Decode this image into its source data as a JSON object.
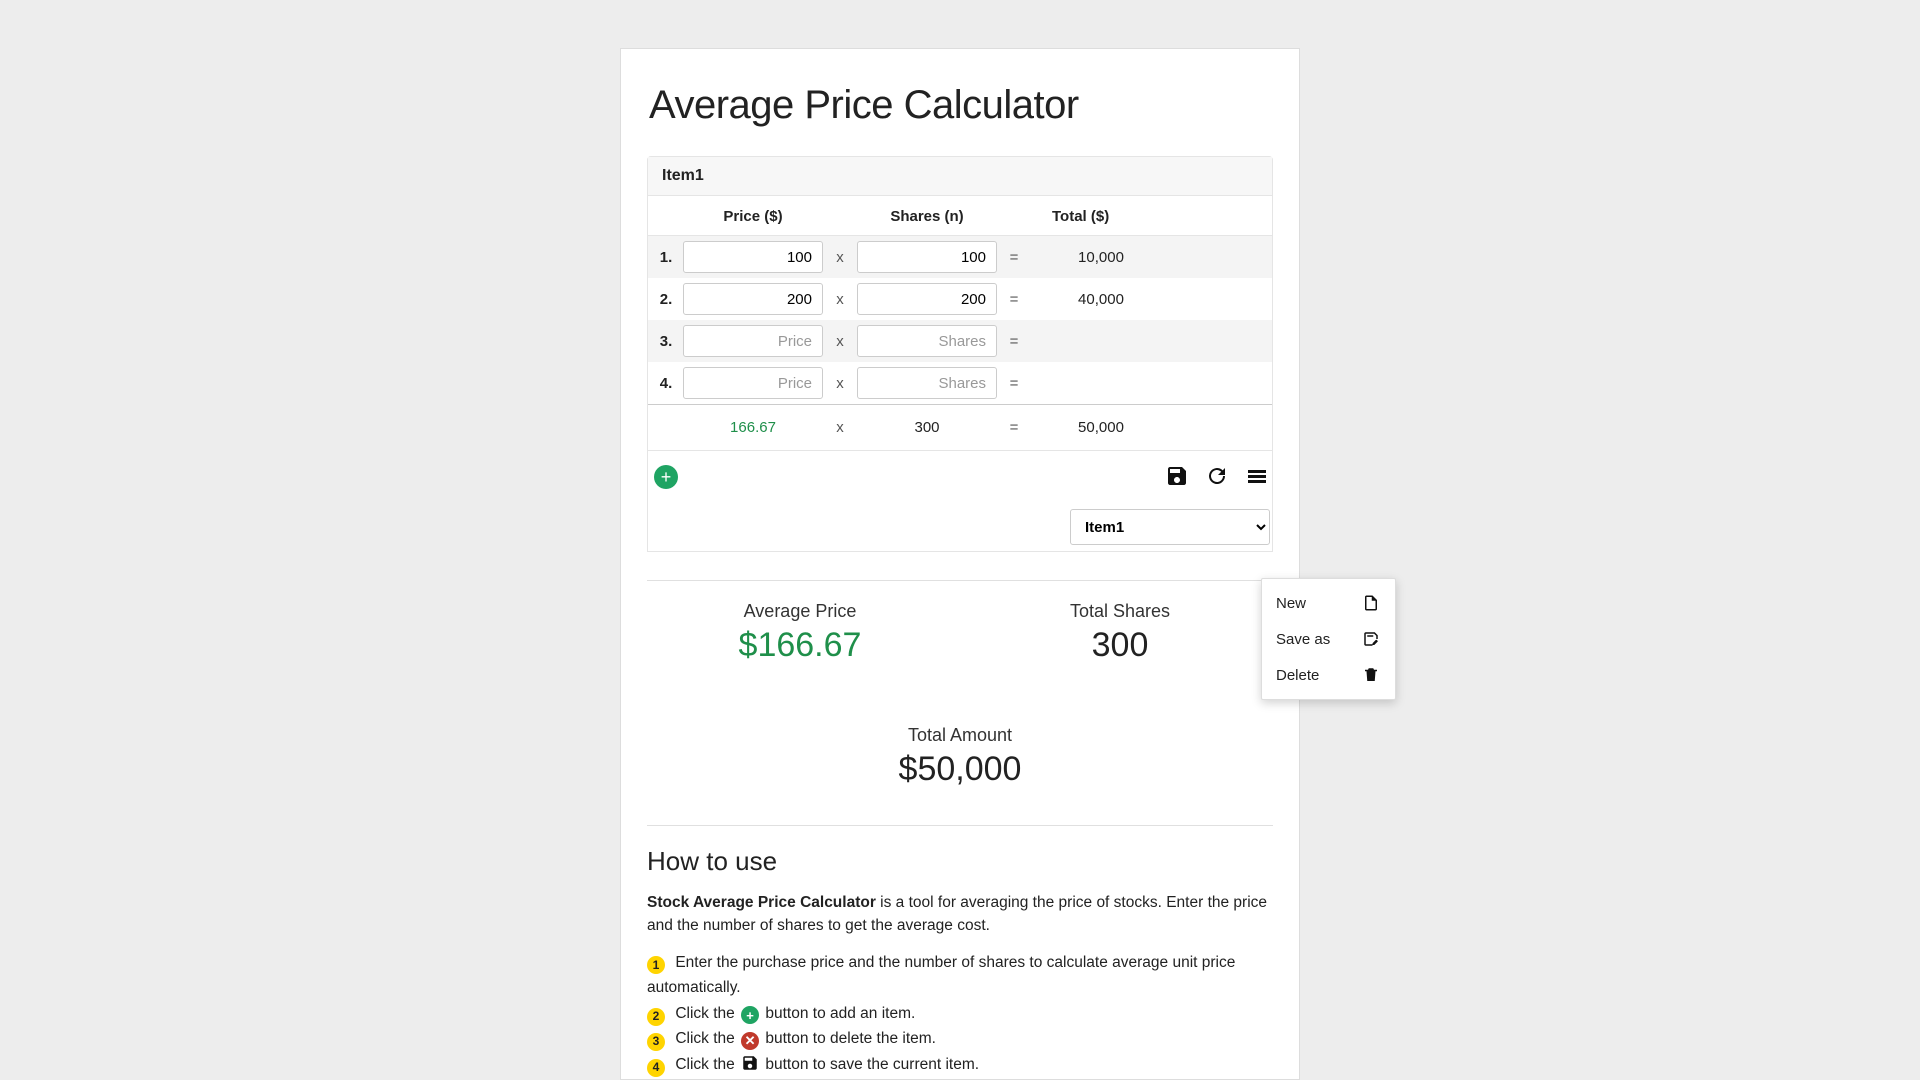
{
  "title": "Average Price Calculator",
  "item_name": "Item1",
  "columns": {
    "price": "Price ($)",
    "shares": "Shares (n)",
    "total": "Total ($)"
  },
  "placeholders": {
    "price": "Price",
    "shares": "Shares"
  },
  "rows": [
    {
      "idx": "1.",
      "price": "100",
      "shares": "100",
      "total": "10,000"
    },
    {
      "idx": "2.",
      "price": "200",
      "shares": "200",
      "total": "40,000"
    },
    {
      "idx": "3.",
      "price": "",
      "shares": "",
      "total": ""
    },
    {
      "idx": "4.",
      "price": "",
      "shares": "",
      "total": ""
    }
  ],
  "totals_row": {
    "avg_price": "166.67",
    "total_shares": "300",
    "total_amount": "50,000"
  },
  "operators": {
    "times": "x",
    "equals": "="
  },
  "dropdown": {
    "selected": "Item1"
  },
  "summary": {
    "avg_price_label": "Average Price",
    "avg_price_value": "$166.67",
    "total_shares_label": "Total Shares",
    "total_shares_value": "300",
    "total_amount_label": "Total Amount",
    "total_amount_value": "$50,000"
  },
  "howto": {
    "heading": "How to use",
    "intro_strong": "Stock Average Price Calculator",
    "intro_rest": " is a tool for averaging the price of stocks. Enter the price and the number of shares to get the average cost.",
    "steps": {
      "s1a": "Enter the purchase price and the number of shares to calculate average unit price automatically.",
      "s2a": "Click the ",
      "s2b": " button to add an item.",
      "s3a": "Click the ",
      "s3b": " button to delete the item.",
      "s4a": "Click the ",
      "s4b": " button to save the current item."
    },
    "badges": {
      "n1": "1",
      "n2": "2",
      "n3": "3",
      "n4": "4",
      "plus": "+",
      "x": "✕"
    }
  },
  "menu": {
    "new": "New",
    "save_as": "Save as",
    "delete": "Delete"
  },
  "colors": {
    "accent_green": "#1fa463",
    "value_green": "#1f8f4a",
    "badge_yellow": "#ffd400",
    "delete_red": "#c0392b"
  }
}
